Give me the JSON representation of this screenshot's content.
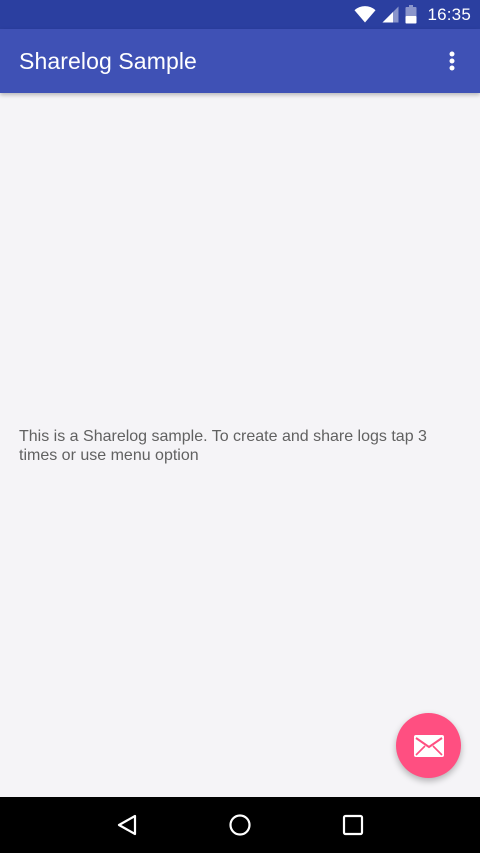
{
  "status_bar": {
    "time": "16:35",
    "icons": [
      "wifi-icon",
      "cell-signal-icon",
      "battery-icon"
    ]
  },
  "app_bar": {
    "title": "Sharelog Sample",
    "overflow_icon": "more-vert-icon",
    "color": "#3f51b5"
  },
  "main": {
    "text": "This is a Sharelog sample. To create and share logs tap 3 times or use menu option"
  },
  "fab": {
    "icon": "email-icon",
    "color": "#ff4f81"
  },
  "nav_bar": {
    "buttons": [
      "back-icon",
      "home-icon",
      "recents-icon"
    ]
  }
}
